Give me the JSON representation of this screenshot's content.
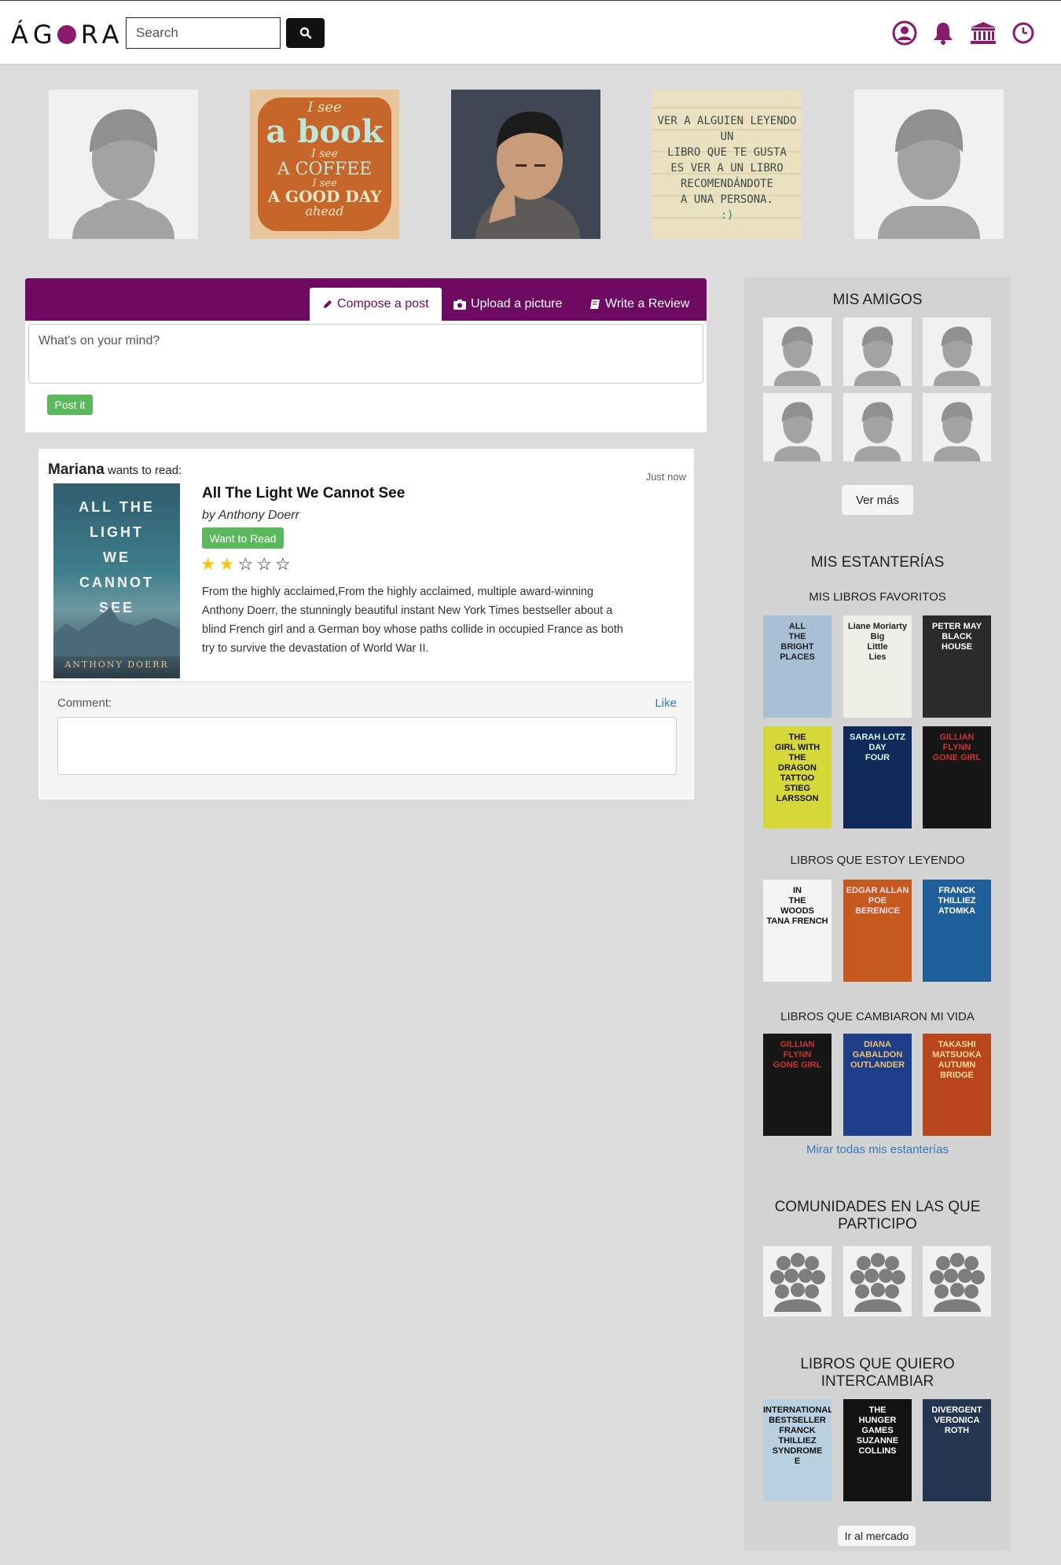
{
  "header": {
    "logo_pre": "Á",
    "logo_post": "RA",
    "logo_g": "G",
    "search_placeholder": "Search",
    "icons": [
      "user-icon",
      "bell-icon",
      "institution-icon",
      "clock-icon"
    ],
    "accent": "#8a1a6b"
  },
  "photos": [
    {
      "type": "placeholder"
    },
    {
      "type": "quote",
      "lines": [
        "I see",
        "a book",
        "I see",
        "A COFFEE",
        "I see",
        "A GOOD DAY",
        "ahead"
      ]
    },
    {
      "type": "portrait"
    },
    {
      "type": "quote2",
      "lines": [
        "VER A ALGUIEN LEYENDO UN",
        "LIBRO QUE TE GUSTA",
        "ES VER A UN LIBRO",
        "RECOMENDÁNDOTE",
        "A UNA PERSONA.",
        ":)"
      ]
    },
    {
      "type": "placeholder"
    }
  ],
  "composer": {
    "tabs": [
      {
        "label": "Compose a post",
        "icon": "pencil-icon"
      },
      {
        "label": "Upload a picture",
        "icon": "camera-icon"
      },
      {
        "label": "Write a Review",
        "icon": "book-icon"
      }
    ],
    "placeholder": "What's on your mind?",
    "post_label": "Post it",
    "bar_color": "#6f0a62"
  },
  "feed": {
    "user": "Mariana",
    "action": "wants to read:",
    "time": "Just now",
    "book": {
      "title": "All The Light We Cannot See",
      "author": "by Anthony Doerr",
      "cover_lines": [
        "ALL THE",
        "LIGHT",
        "WE",
        "CANNOT",
        "SEE"
      ],
      "cover_author": "ANTHONY DOERR",
      "status": "Want to Read",
      "rating": 2,
      "max_rating": 5,
      "description": "From the highly acclaimed,From the highly acclaimed, multiple award-winning Anthony Doerr, the stunningly beautiful instant New York Times bestseller about a blind French girl and a German boy whose paths collide in occupied France as both try to survive the devastation of World War II."
    },
    "comment_label": "Comment:",
    "like_label": "Like"
  },
  "sidebar": {
    "friends_title": "MIS AMIGOS",
    "more_label": "Ver más",
    "shelves_title": "MIS ESTANTERÍAS",
    "fav_title": "MIS LIBROS FAVORITOS",
    "fav_books": [
      {
        "lines": [
          "ALL",
          "THE",
          "BRIGHT",
          "PLACES"
        ],
        "bg": "#a9bfd6",
        "fg": "#222"
      },
      {
        "lines": [
          "Liane Moriarty",
          "Big",
          "Little",
          "Lies"
        ],
        "bg": "#eef0e8",
        "fg": "#222"
      },
      {
        "lines": [
          "PETER MAY",
          "BLACK",
          "HOUSE"
        ],
        "bg": "#2b2b2b",
        "fg": "#fff"
      },
      {
        "lines": [
          "THE",
          "GIRL WITH",
          "THE",
          "DRAGON",
          "TATTOO",
          "STIEG",
          "LARSSON"
        ],
        "bg": "#d6d83a",
        "fg": "#111"
      },
      {
        "lines": [
          "SARAH LOTZ",
          "DAY",
          "FOUR"
        ],
        "bg": "#0f2a5a",
        "fg": "#cfe"
      },
      {
        "lines": [
          "GILLIAN",
          "FLYNN",
          "GONE GIRL"
        ],
        "bg": "#161616",
        "fg": "#c33"
      }
    ],
    "reading_title": "LIBROS QUE ESTOY LEYENDO",
    "reading_books": [
      {
        "lines": [
          "IN",
          "THE",
          "WOODS",
          "TANA FRENCH"
        ],
        "bg": "#f4f4f4",
        "fg": "#111"
      },
      {
        "lines": [
          "EDGAR ALLAN POE",
          "BERENICE"
        ],
        "bg": "#c65a1e",
        "fg": "#fde"
      },
      {
        "lines": [
          "FRANCK",
          "THILLIEZ",
          "ATOMKA"
        ],
        "bg": "#1f5f9a",
        "fg": "#fff"
      }
    ],
    "changed_title": "LIBROS QUE CAMBIARON MI VIDA",
    "changed_books": [
      {
        "lines": [
          "GILLIAN",
          "FLYNN",
          "GONE GIRL"
        ],
        "bg": "#161616",
        "fg": "#c33"
      },
      {
        "lines": [
          "DIANA",
          "GABALDON",
          "OUTLANDER"
        ],
        "bg": "#1d3f8a",
        "fg": "#f0c070"
      },
      {
        "lines": [
          "TAKASHI",
          "MATSUOKA",
          "AUTUMN",
          "BRIDGE"
        ],
        "bg": "#b9451a",
        "fg": "#ffd9a0"
      }
    ],
    "all_shelves_link": "Mirar todas mis estanterías",
    "communities_title_1": "COMUNIDADES EN LAS QUE",
    "communities_title_2": "PARTICIPO",
    "exchange_title_1": "LIBROS QUE QUIERO",
    "exchange_title_2": "INTERCAMBIAR",
    "exchange_books": [
      {
        "lines": [
          "INTERNATIONAL BESTSELLER",
          "FRANCK THILLIEZ",
          "SYNDROME",
          "E"
        ],
        "bg": "#b8d0e0",
        "fg": "#111"
      },
      {
        "lines": [
          "THE",
          "HUNGER",
          "GAMES",
          "SUZANNE",
          "COLLINS"
        ],
        "bg": "#121212",
        "fg": "#fff"
      },
      {
        "lines": [
          "DIVERGENT",
          "VERONICA ROTH"
        ],
        "bg": "#24364f",
        "fg": "#fff"
      }
    ],
    "market_label": "Ir al mercado"
  }
}
